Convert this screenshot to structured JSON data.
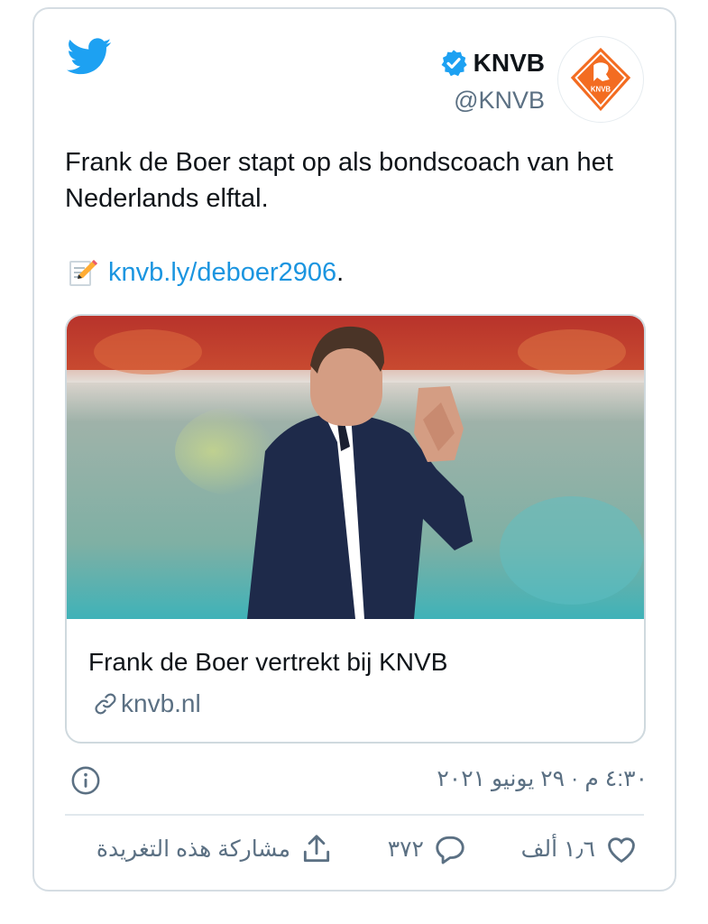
{
  "author": {
    "name": "KNVB",
    "handle": "@KNVB",
    "avatar_text": "KNVB"
  },
  "tweet": {
    "text": "Frank de Boer stapt op als bondscoach van het Nederlands elftal.",
    "link_text": "knvb.ly/deboer2906",
    "link_suffix": "."
  },
  "link_card": {
    "title": "Frank de Boer vertrekt bij KNVB",
    "domain": "knvb.nl"
  },
  "meta": {
    "timestamp": "٤:٣٠ م · ٢٩ يونيو ٢٠٢١"
  },
  "actions": {
    "likes": "١٫٦ ألف",
    "replies": "٣٧٢",
    "share_label": "مشاركة هذه التغريدة"
  },
  "colors": {
    "twitter_blue": "#1da1f2",
    "link_blue": "#1b95e0",
    "knvb_orange": "#f36c21",
    "secondary_text": "#5b7083"
  },
  "icons": [
    "twitter-bird-icon",
    "verified-badge-icon",
    "memo-icon",
    "link-icon",
    "info-icon",
    "heart-icon",
    "reply-bubble-icon",
    "share-icon"
  ]
}
